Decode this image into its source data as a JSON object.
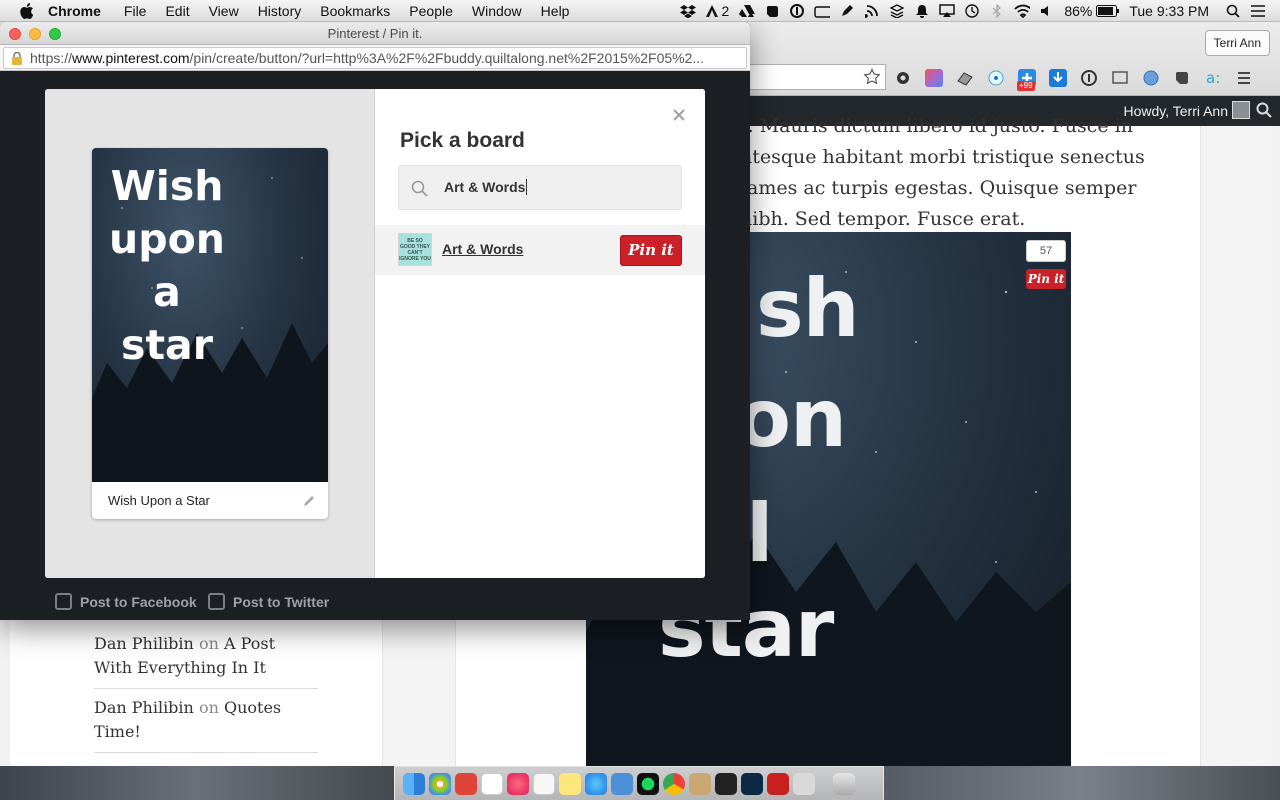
{
  "menubar": {
    "app": "Chrome",
    "items": [
      "File",
      "Edit",
      "View",
      "History",
      "Bookmarks",
      "People",
      "Window",
      "Help"
    ],
    "adobe_count": "2",
    "battery": "86%",
    "clock": "Tue 9:33 PM"
  },
  "browser": {
    "profile": "Terri Ann",
    "extension_badge": "+99"
  },
  "wp_admin": {
    "howdy": "Howdy, Terri Ann"
  },
  "article": {
    "lines": [
      "t. Mauris dictum libero id justo. Fusce in",
      "ntesque habitant morbi tristique senectus",
      "fames ac turpis egestas. Quisque semper",
      "nibh. Sed tempor. Fusce erat."
    ],
    "image_words": [
      "sh",
      "on",
      "l",
      "star"
    ],
    "pin_count": "57",
    "pinit_label": "Pin it"
  },
  "comments": [
    {
      "author": "Dan Philibin",
      "on": "on",
      "post": "A Post With Everything In It"
    },
    {
      "author": "Dan Philibin",
      "on": "on",
      "post": "Quotes Time!"
    }
  ],
  "popup": {
    "window_title": "Pinterest / Pin it.",
    "url_prefix": "https://",
    "url_domain": "www.pinterest.com",
    "url_rest": "/pin/create/button/?url=http%3A%2F%2Fbuddy.quiltalong.net%2F2015%2F05%2...",
    "pin": {
      "overlay_lines": [
        "Wish",
        "upon",
        "a",
        "star"
      ],
      "description": "Wish Upon a Star"
    },
    "board_picker": {
      "title": "Pick a board",
      "search_value": "Art & Words",
      "results": [
        {
          "name": "Art & Words",
          "thumb_text": "BE SO GOOD THEY CAN'T IGNORE YOU",
          "action": "Pin it"
        }
      ]
    },
    "footer": {
      "facebook": "Post to Facebook",
      "twitter": "Post to Twitter"
    }
  },
  "colors": {
    "pinterest_red": "#cb2027",
    "popup_bg": "#1c1f23"
  }
}
